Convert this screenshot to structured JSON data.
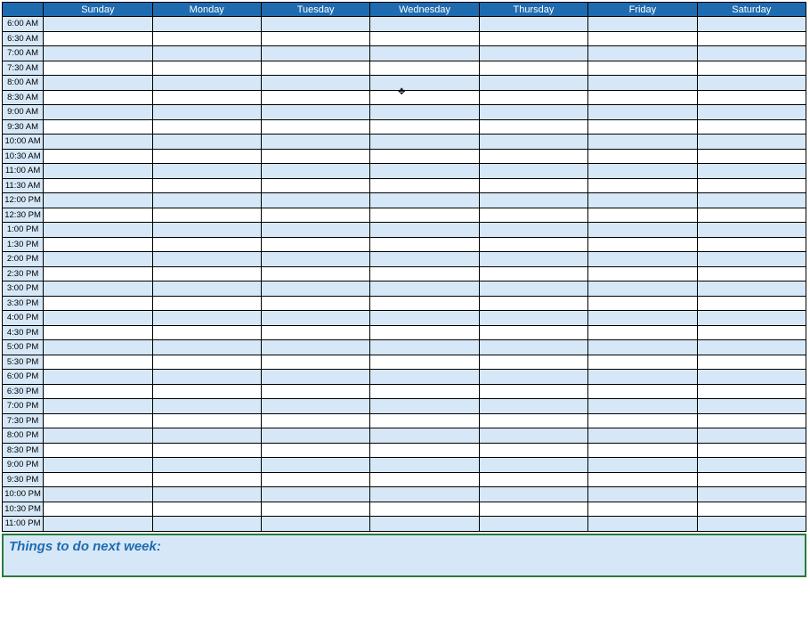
{
  "days": [
    "Sunday",
    "Monday",
    "Tuesday",
    "Wednesday",
    "Thursday",
    "Friday",
    "Saturday"
  ],
  "times": [
    "6:00 AM",
    "6:30 AM",
    "7:00 AM",
    "7:30 AM",
    "8:00 AM",
    "8:30 AM",
    "9:00 AM",
    "9:30 AM",
    "10:00 AM",
    "10:30 AM",
    "11:00 AM",
    "11:30 AM",
    "12:00 PM",
    "12:30 PM",
    "1:00 PM",
    "1:30 PM",
    "2:00 PM",
    "2:30 PM",
    "3:00 PM",
    "3:30 PM",
    "4:00 PM",
    "4:30 PM",
    "5:00 PM",
    "5:30 PM",
    "6:00 PM",
    "6:30 PM",
    "7:00 PM",
    "7:30 PM",
    "8:00 PM",
    "8:30 PM",
    "9:00 PM",
    "9:30 PM",
    "10:00 PM",
    "10:30 PM",
    "11:00 PM"
  ],
  "todo": {
    "heading": "Things to do next week:"
  }
}
